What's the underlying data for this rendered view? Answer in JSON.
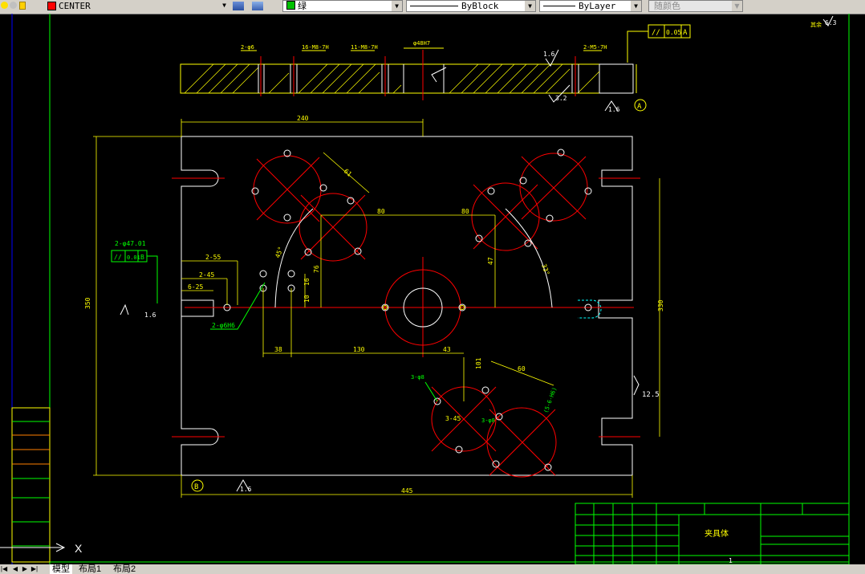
{
  "toolbar": {
    "layer": {
      "name": "CENTER",
      "color": "#ff0000"
    },
    "color_control": {
      "label": "绿",
      "color": "#00c000"
    },
    "linetype": "ByBlock",
    "lineweight": "ByLayer",
    "plot_style": "随颜色"
  },
  "drawing": {
    "dims": {
      "d_top_240": "240",
      "d_445": "445",
      "d_80a": "80",
      "d_80b": "80",
      "d_38": "38",
      "d_130": "130",
      "d_43": "43",
      "d_350": "350",
      "d_330": "330",
      "d_47": "47",
      "d_38b": "38",
      "d_76": "76",
      "d_16": "16",
      "d_10": "10",
      "d_101": "101",
      "d_60": "60",
      "d_2_45": "2-45",
      "d_2_55": "2-55",
      "d_6_25": "6-25",
      "d_61": "61",
      "d_45deg": "45°",
      "d_33deg": "33°",
      "d_3_45b": "3-45"
    },
    "notes": {
      "tol_flat_1": "//",
      "tol_flat_1_val": "0.05",
      "tol_flat_1_ref": "A",
      "tol_par_2": "//",
      "tol_par_2_val": "0.01",
      "tol_par_2_ref": "B",
      "hole_note_1": "2-φ47.01",
      "hole_note_2": "2-φ6H6",
      "hole_note_3": "3-φ8",
      "hole_note_4": "3-φ8",
      "hole_note_5": "(5-6-H6)",
      "top_note_1": "2-φ6",
      "top_note_2": "16-M8-7H",
      "top_note_3": "11-M8-7H",
      "top_note_4": "2-M5-7H",
      "top_note_5": "φ48H7",
      "rough_1": "1.6",
      "rough_2": "1.6",
      "rough_3": "1.6",
      "rough_4": "3.2",
      "rough_5": "1.6",
      "rough_6": "12.5",
      "rough_top": "6.3",
      "rough_top_label": "其余",
      "datum_A": "A",
      "datum_B": "B"
    },
    "title_block": {
      "part_name": "夹具体",
      "sheet": "1"
    }
  },
  "tabs": [
    "模型",
    "布局1",
    "布局2"
  ]
}
